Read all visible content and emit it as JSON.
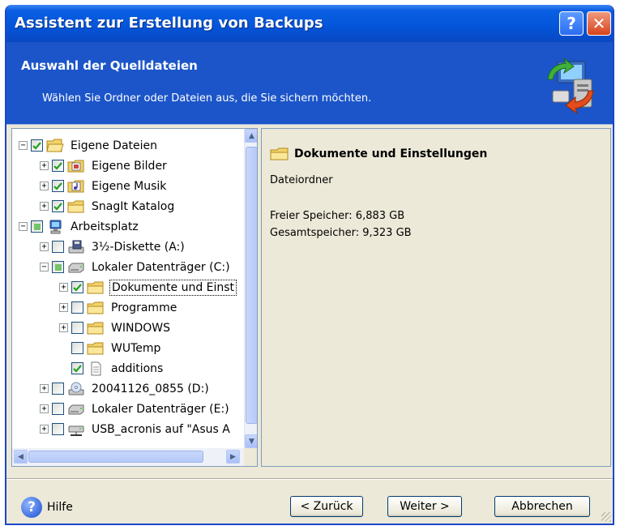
{
  "window": {
    "title": "Assistent zur Erstellung von Backups",
    "help_glyph": "?",
    "close_glyph": "✕"
  },
  "header": {
    "title": "Auswahl der Quelldateien",
    "subtitle": "Wählen Sie Ordner oder Dateien aus, die Sie sichern möchten.",
    "icon": "backup-computer-icon"
  },
  "tree": {
    "items": [
      {
        "label": "Eigene Dateien",
        "level": 0,
        "expander": "minus",
        "check": "checked",
        "icon": "folder-open-icon"
      },
      {
        "label": "Eigene Bilder",
        "level": 1,
        "expander": "plus",
        "check": "checked",
        "icon": "pictures-folder-icon"
      },
      {
        "label": "Eigene Musik",
        "level": 1,
        "expander": "plus",
        "check": "checked",
        "icon": "music-folder-icon"
      },
      {
        "label": "SnagIt Katalog",
        "level": 1,
        "expander": "plus",
        "check": "checked",
        "icon": "folder-icon"
      },
      {
        "label": "Arbeitsplatz",
        "level": 0,
        "expander": "minus",
        "check": "partial",
        "icon": "computer-icon"
      },
      {
        "label": "3½-Diskette (A:)",
        "level": 1,
        "expander": "plus",
        "check": "unchecked",
        "icon": "floppy-drive-icon"
      },
      {
        "label": "Lokaler Datenträger (C:)",
        "level": 1,
        "expander": "minus",
        "check": "partial",
        "icon": "hard-drive-icon"
      },
      {
        "label": "Dokumente und Einst",
        "level": 2,
        "expander": "plus",
        "check": "checked",
        "icon": "folder-icon",
        "selected": true
      },
      {
        "label": "Programme",
        "level": 2,
        "expander": "plus",
        "check": "unchecked",
        "icon": "folder-icon"
      },
      {
        "label": "WINDOWS",
        "level": 2,
        "expander": "plus",
        "check": "unchecked",
        "icon": "folder-icon"
      },
      {
        "label": "WUTemp",
        "level": 2,
        "expander": "none",
        "check": "unchecked",
        "icon": "folder-icon"
      },
      {
        "label": "additions",
        "level": 2,
        "expander": "none",
        "check": "checked",
        "icon": "file-icon"
      },
      {
        "label": "20041126_0855 (D:)",
        "level": 1,
        "expander": "plus",
        "check": "unchecked",
        "icon": "cd-drive-icon"
      },
      {
        "label": "Lokaler Datenträger (E:)",
        "level": 1,
        "expander": "plus",
        "check": "unchecked",
        "icon": "hard-drive-icon"
      },
      {
        "label": "USB_acronis auf \"Asus A",
        "level": 1,
        "expander": "plus",
        "check": "unchecked",
        "icon": "network-drive-icon"
      }
    ]
  },
  "details": {
    "title": "Dokumente und Einstellungen",
    "type": "Dateiordner",
    "free_space": "Freier Speicher: 6,883 GB",
    "total_space": "Gesamtspeicher:  9,323 GB"
  },
  "footer": {
    "help_label": "Hilfe",
    "back_label": "< Zurück",
    "next_label": "Weiter >",
    "cancel_label": "Abbrechen"
  },
  "colors": {
    "title_bar": "#0a5fe3",
    "header_bg": "#1c55c9",
    "face": "#ece9d8",
    "check_green": "#21a121"
  }
}
